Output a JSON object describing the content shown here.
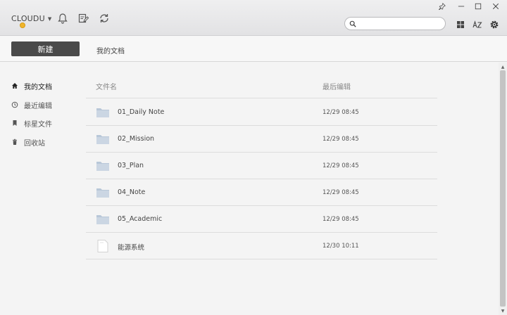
{
  "app": {
    "brand": "CLOUDU"
  },
  "search": {
    "placeholder": ""
  },
  "toolbar": {
    "new_label": "新建",
    "breadcrumb": "我的文档"
  },
  "sidebar": {
    "items": [
      {
        "label": "我的文档",
        "icon": "home-icon"
      },
      {
        "label": "最近编辑",
        "icon": "clock-icon"
      },
      {
        "label": "标星文件",
        "icon": "bookmark-icon"
      },
      {
        "label": "回收站",
        "icon": "trash-icon"
      }
    ]
  },
  "list": {
    "headers": {
      "name": "文件名",
      "modified": "最后编辑"
    },
    "rows": [
      {
        "name": "01_Daily Note",
        "modified": "12/29 08:45",
        "type": "folder"
      },
      {
        "name": "02_Mission",
        "modified": "12/29 08:45",
        "type": "folder"
      },
      {
        "name": "03_Plan",
        "modified": "12/29 08:45",
        "type": "folder"
      },
      {
        "name": "04_Note",
        "modified": "12/29 08:45",
        "type": "folder"
      },
      {
        "name": "05_Academic",
        "modified": "12/29 08:45",
        "type": "folder"
      },
      {
        "name": "能源系统",
        "modified": "12/30 10:11",
        "type": "document"
      }
    ]
  },
  "colors": {
    "accent_button": "#4a4a4a",
    "folder": "#b8c7d8",
    "vip": "#f0b52c"
  }
}
